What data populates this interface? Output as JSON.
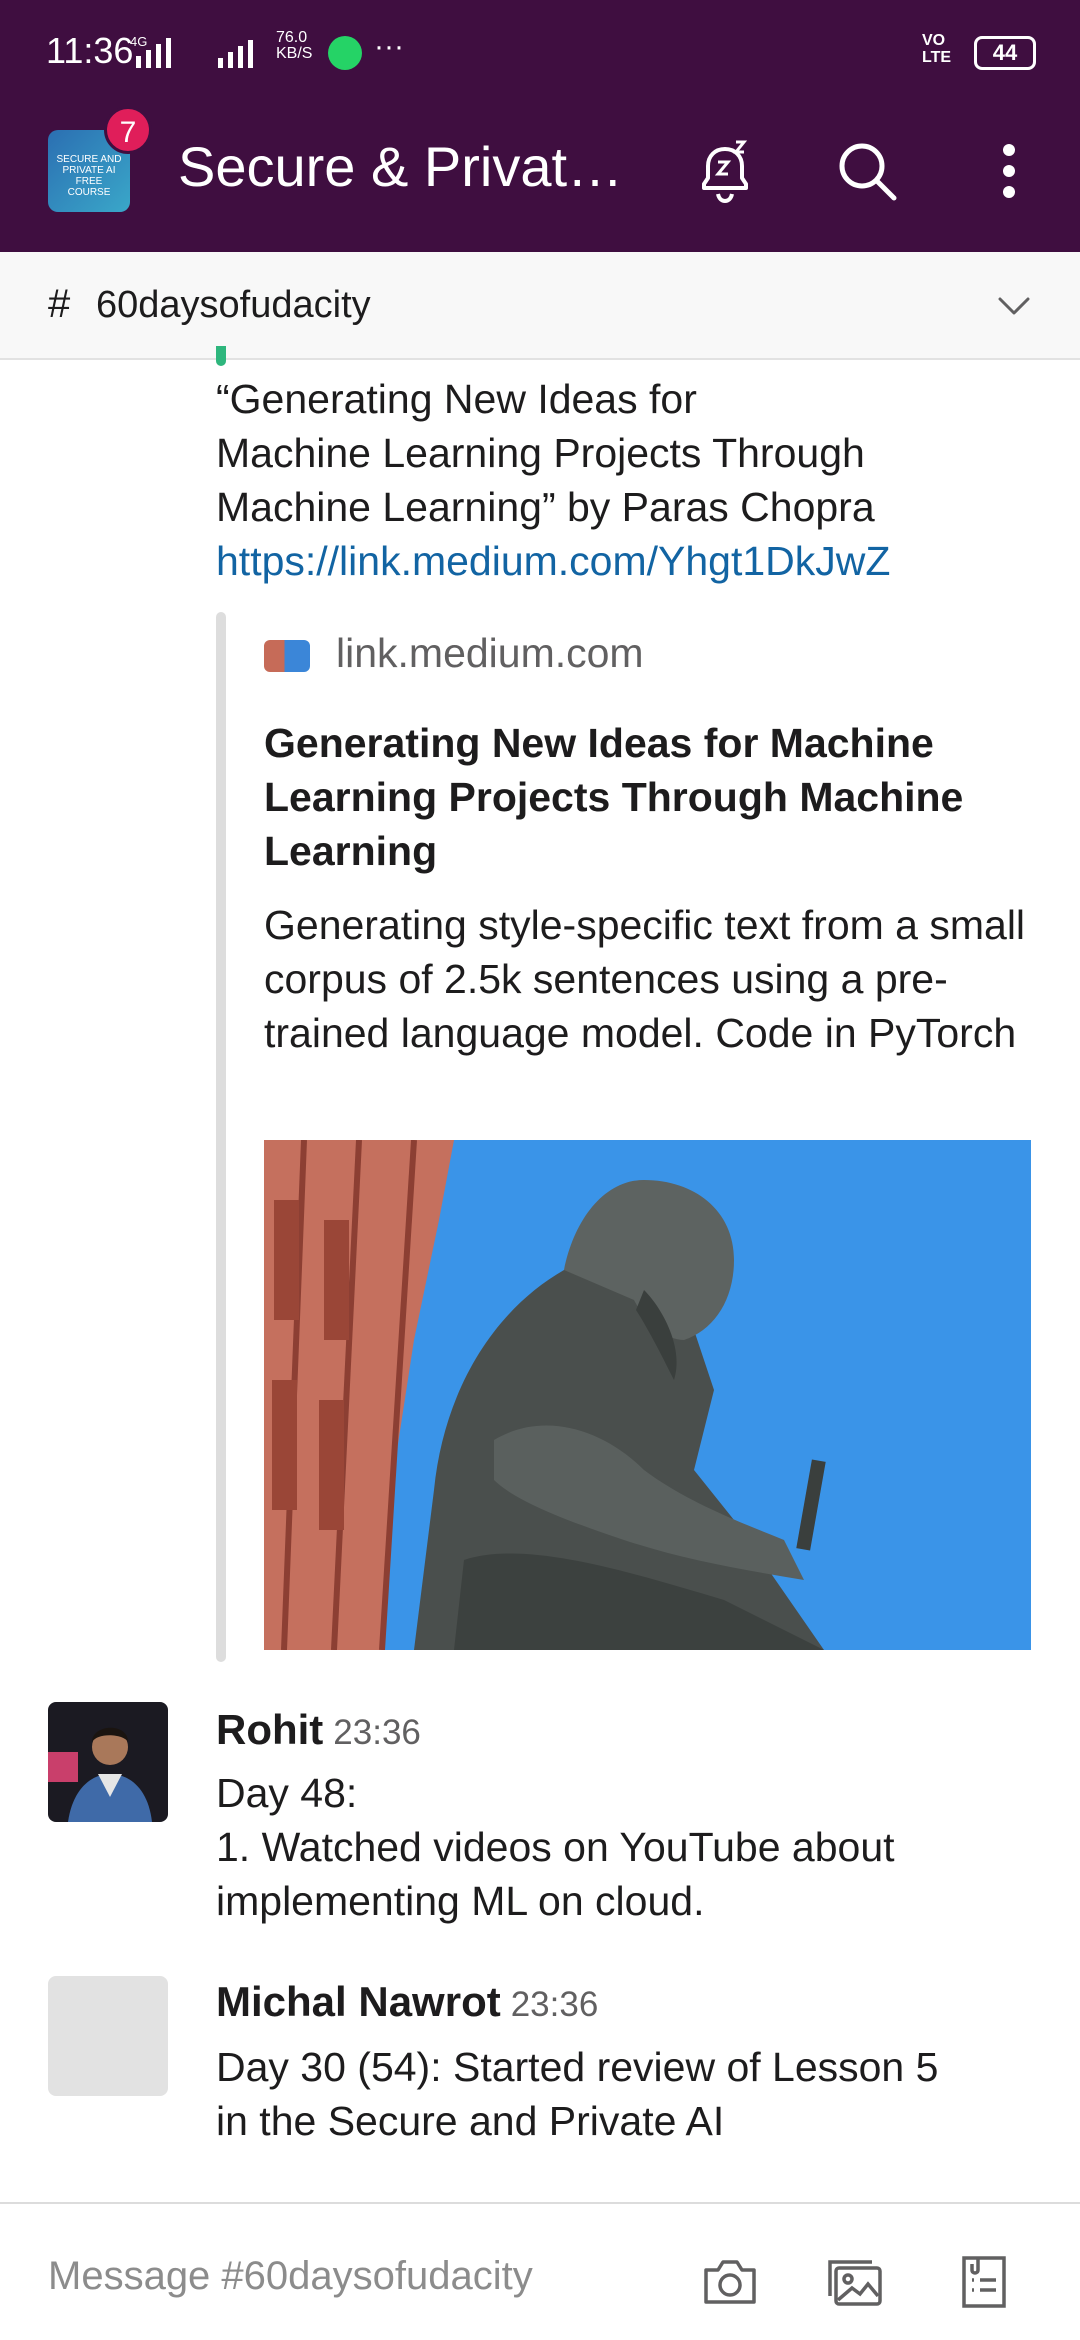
{
  "status_bar": {
    "time": "11:36",
    "network": "4G",
    "speed_value": "76.0",
    "speed_unit": "KB/S",
    "overflow": "···",
    "volte": "VO LTE",
    "battery": "44"
  },
  "app_bar": {
    "workspace_icon_text": "SECURE AND PRIVATE AI FREE COURSE",
    "badge_count": "7",
    "title": "Secure & Privat…"
  },
  "channel": {
    "hash": "#",
    "name": "60daysofudacity"
  },
  "message_partial": {
    "line1": "“Generating New Ideas for",
    "line2": "Machine Learning Projects Through",
    "line3": "Machine Learning” by Paras Chopra",
    "link": "https://link.medium.com/Yhgt1DkJwZ"
  },
  "unfurl": {
    "domain": "link.medium.com",
    "title": "Generating New Ideas for Machine Learning Projects Through Machine Learning",
    "description": "Generating style-specific text from a small corpus of 2.5k sentences using a pre-trained language model. Code in PyTorch"
  },
  "messages": [
    {
      "sender": "Rohit",
      "time": "23:36",
      "line1": "Day 48:",
      "line2": "1. Watched videos on YouTube about",
      "line3": "implementing ML on cloud."
    },
    {
      "sender": "Michal Nawrot",
      "time": "23:36",
      "line1": "Day 30 (54): Started review of Lesson 5",
      "line2": "in the Secure and Private AI"
    }
  ],
  "composer": {
    "placeholder": "Message #60daysofudacity"
  },
  "colors": {
    "aubergine": "#3f0e40",
    "link": "#1264a3",
    "badge": "#e01e5a"
  }
}
